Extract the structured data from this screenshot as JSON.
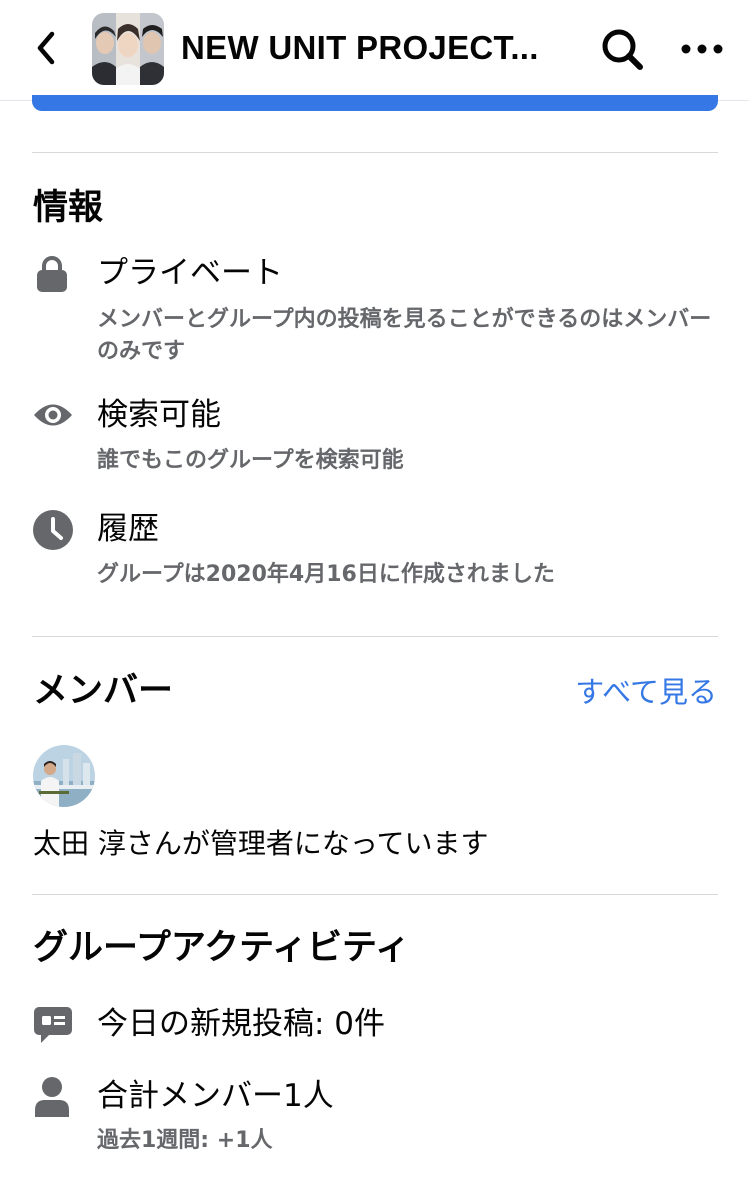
{
  "header": {
    "back_icon": "chevron-left-icon",
    "title": "NEW UNIT PROJECT...",
    "search_icon": "search-icon",
    "more_icon": "more-icon"
  },
  "info": {
    "title": "情報",
    "items": [
      {
        "icon": "lock-icon",
        "title": "プライベート",
        "sub": "メンバーとグループ内の投稿を見ることができるのはメンバーのみです"
      },
      {
        "icon": "eye-icon",
        "title": "検索可能",
        "sub": "誰でもこのグループを検索可能"
      },
      {
        "icon": "clock-icon",
        "title": "履歴",
        "sub": "グループは2020年4月16日に作成されました"
      }
    ]
  },
  "members": {
    "title": "メンバー",
    "see_all": "すべて見る",
    "admin_text": "太田 淳さんが管理者になっています"
  },
  "activity": {
    "title": "グループアクティビティ",
    "items": [
      {
        "icon": "chat-icon",
        "title": "今日の新規投稿: 0件",
        "sub": ""
      },
      {
        "icon": "person-icon",
        "title": "合計メンバー1人",
        "sub": "過去1週間: +1人"
      }
    ]
  },
  "colors": {
    "accent": "#3578e5",
    "icon_gray": "#65676b",
    "sub_text": "#65676b",
    "divider": "#d6d8dc"
  }
}
